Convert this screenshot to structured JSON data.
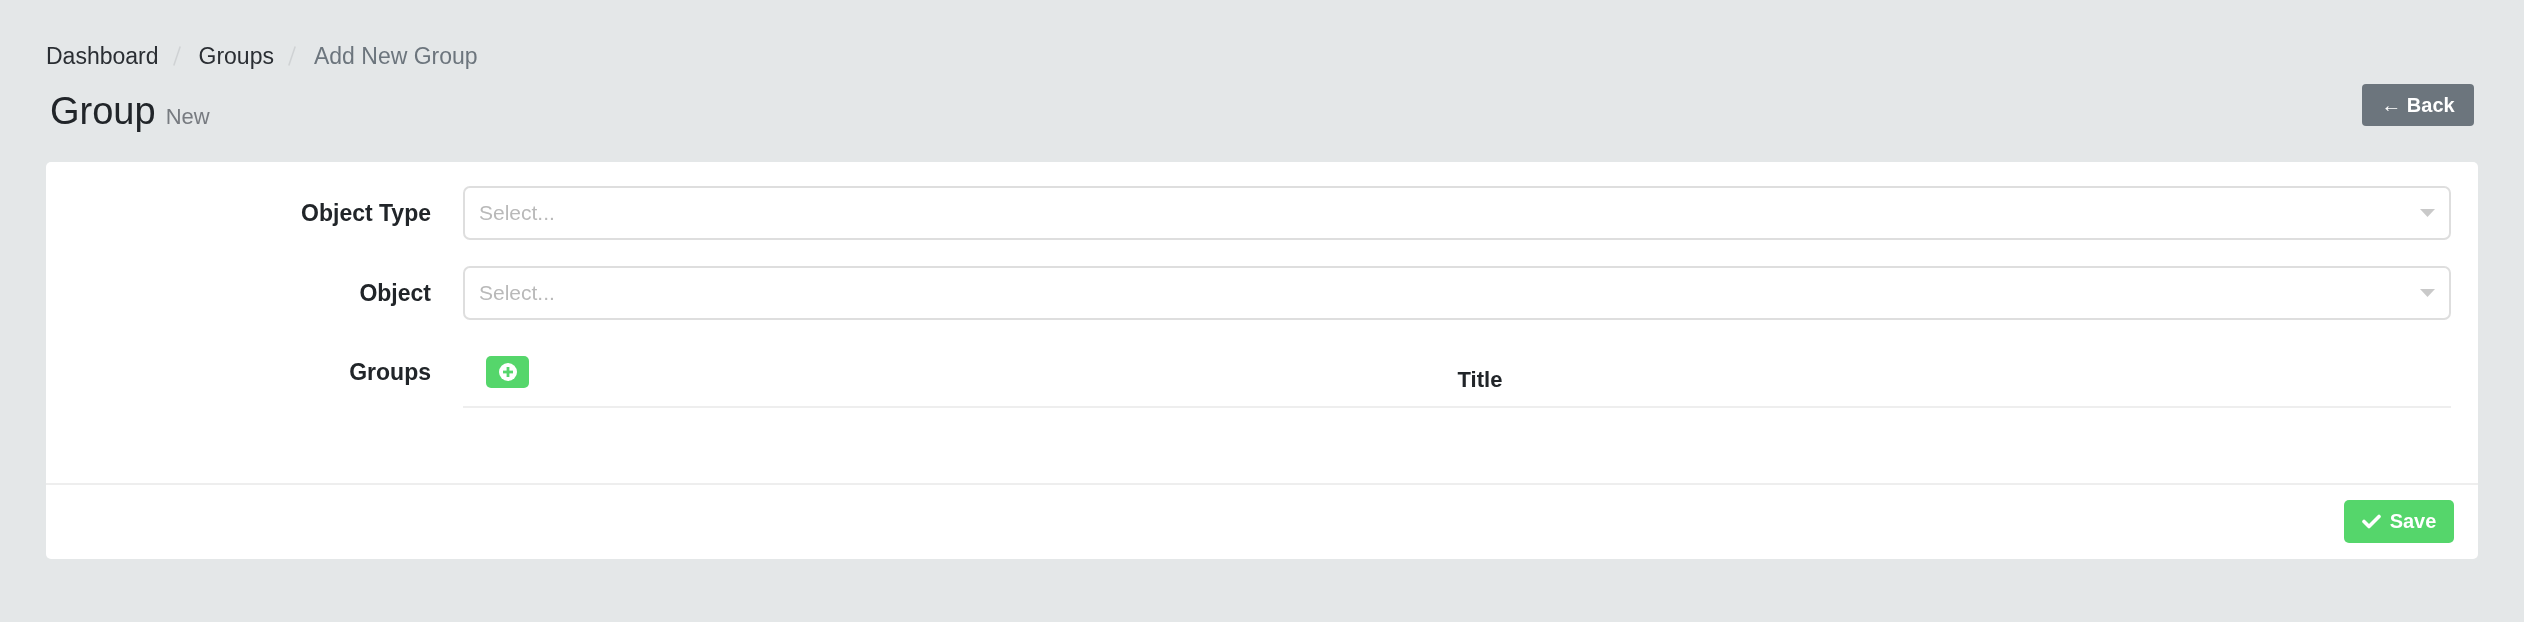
{
  "breadcrumb": [
    {
      "label": "Dashboard",
      "current": false
    },
    {
      "label": "Groups",
      "current": false
    },
    {
      "label": "Add New Group",
      "current": true
    }
  ],
  "header": {
    "title": "Group",
    "subtitle": "New",
    "back_button": "← Back"
  },
  "form": {
    "fields": [
      {
        "label": "Object Type",
        "kind": "select",
        "placeholder": "Select..."
      },
      {
        "label": "Object",
        "kind": "select",
        "placeholder": "Select..."
      },
      {
        "label": "Groups",
        "kind": "table",
        "add_button": true,
        "columns": [
          "Title"
        ]
      }
    ]
  },
  "footer": {
    "save_button": "Save"
  }
}
